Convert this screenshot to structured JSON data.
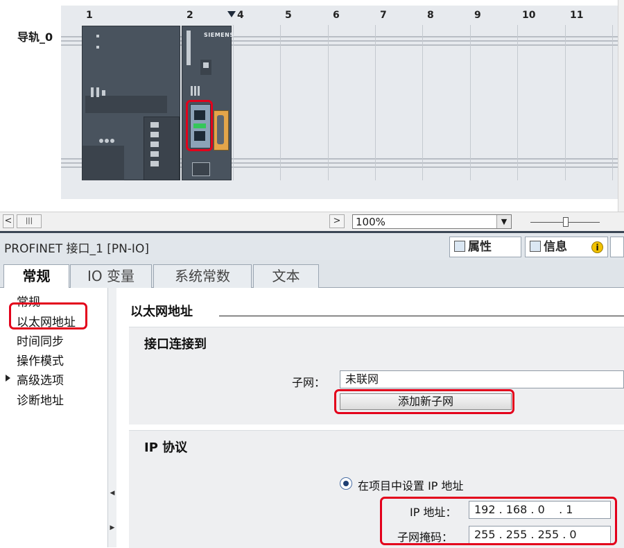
{
  "device_view": {
    "rail_label": "导轨_0",
    "slots": [
      "1",
      "2",
      "4",
      "5",
      "6",
      "7",
      "8",
      "9",
      "10",
      "11"
    ]
  },
  "toolbar": {
    "zoom_value": "100%"
  },
  "inspector": {
    "title": "PROFINET 接口_1 [PN-IO]",
    "panel_tabs": [
      "属性",
      "信息"
    ],
    "info_badge": "i",
    "tabs": [
      "常规",
      "IO 变量",
      "系统常数",
      "文本"
    ],
    "nav_items": [
      "常规",
      "以太网地址",
      "时间同步",
      "操作模式",
      "高级选项",
      "诊断地址"
    ]
  },
  "content": {
    "section_title": "以太网地址",
    "interface_group": {
      "title": "接口连接到",
      "subnet_label": "子网：",
      "subnet_value": "未联网",
      "add_subnet_button": "添加新子网"
    },
    "ip_group": {
      "title": "IP 协议",
      "radio_label": "在项目中设置 IP 地址",
      "ip_label": "IP 地址：",
      "ip_value": "192 . 168 . 0    . 1",
      "mask_label": "子网掩码：",
      "mask_value": "255 . 255 . 255 . 0"
    }
  },
  "colors": {
    "highlight": "#e3001b",
    "panel_bg": "#e1e6eb",
    "module": "#49535e"
  }
}
